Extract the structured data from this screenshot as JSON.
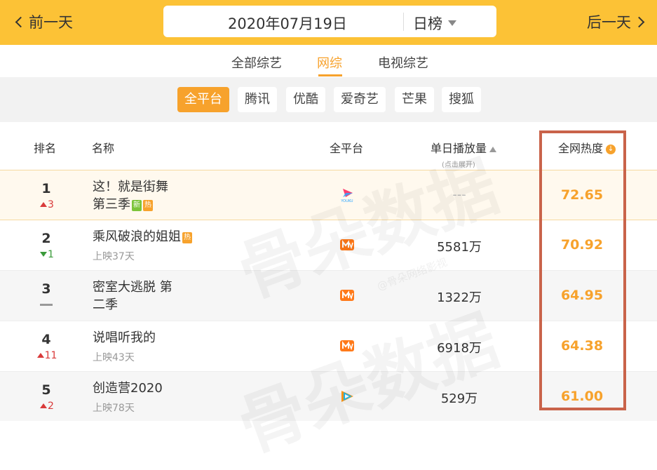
{
  "header": {
    "prev_label": "前一天",
    "next_label": "后一天",
    "date": "2020年07月19日",
    "rank_type": "日榜"
  },
  "category_tabs": [
    {
      "label": "全部综艺",
      "active": false
    },
    {
      "label": "网综",
      "active": true
    },
    {
      "label": "电视综艺",
      "active": false
    }
  ],
  "platforms": [
    {
      "label": "全平台",
      "active": true
    },
    {
      "label": "腾讯",
      "active": false
    },
    {
      "label": "优酷",
      "active": false
    },
    {
      "label": "爱奇艺",
      "active": false
    },
    {
      "label": "芒果",
      "active": false
    },
    {
      "label": "搜狐",
      "active": false
    }
  ],
  "table": {
    "headers": {
      "rank": "排名",
      "name": "名称",
      "platform": "全平台",
      "plays": "单日播放量",
      "plays_hint": "(点击展开)",
      "heat": "全网热度"
    },
    "rows": [
      {
        "rank": "1",
        "change": "3",
        "direction": "up",
        "title_line1": "这！就是街舞",
        "title_line2": "第三季",
        "tags": [
          "新",
          "热"
        ],
        "sub": "",
        "platform": "youku",
        "plays": "---",
        "heat": "72.65"
      },
      {
        "rank": "2",
        "change": "1",
        "direction": "down",
        "title_line1": "乘风破浪的姐姐",
        "title_line2": "",
        "tags": [
          "热"
        ],
        "sub": "上映37天",
        "platform": "mango",
        "plays": "5581万",
        "heat": "70.92"
      },
      {
        "rank": "3",
        "change": "",
        "direction": "flat",
        "title_line1": "密室大逃脱 第",
        "title_line2": "二季",
        "tags": [],
        "sub": "",
        "platform": "mango",
        "plays": "1322万",
        "heat": "64.95"
      },
      {
        "rank": "4",
        "change": "11",
        "direction": "up",
        "title_line1": "说唱听我的",
        "title_line2": "",
        "tags": [],
        "sub": "上映43天",
        "platform": "mango",
        "plays": "6918万",
        "heat": "64.38"
      },
      {
        "rank": "5",
        "change": "2",
        "direction": "up",
        "title_line1": "创造营2020",
        "title_line2": "",
        "tags": [],
        "sub": "上映78天",
        "platform": "tencent",
        "plays": "529万",
        "heat": "61.00"
      }
    ]
  },
  "watermark": {
    "text": "骨朵数据",
    "sub": "@骨朵网络影视"
  },
  "colors": {
    "brand_yellow": "#fcc236",
    "accent_orange": "#f7a22c",
    "highlight_frame": "#c9634a",
    "up_red": "#d93a3a",
    "down_green": "#3a9a3a"
  }
}
